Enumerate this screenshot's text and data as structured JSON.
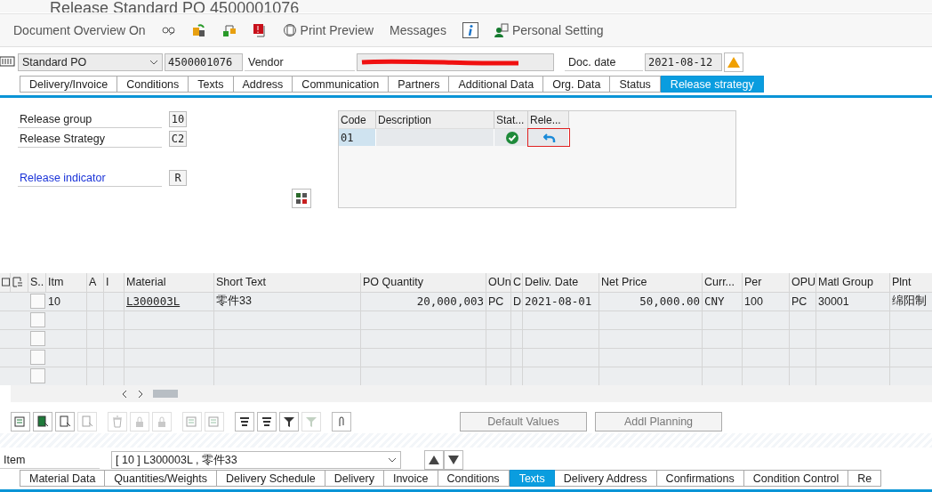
{
  "window": {
    "title": "Release Standard PO 4500001076"
  },
  "toolbar": {
    "items": [
      {
        "kind": "text",
        "label": "Document Overview On"
      },
      {
        "kind": "icon"
      },
      {
        "kind": "icon"
      },
      {
        "kind": "icon"
      },
      {
        "kind": "icon"
      },
      {
        "kind": "icon_text",
        "label": "Print Preview"
      },
      {
        "kind": "text",
        "label": "Messages"
      },
      {
        "kind": "icon"
      },
      {
        "kind": "icon_text",
        "label": "Personal Setting"
      }
    ]
  },
  "header": {
    "doc_type": "Standard PO",
    "po_number": "4500001076",
    "vendor_label": "Vendor",
    "doc_date_label": "Doc. date",
    "doc_date": "2021-08-12"
  },
  "header_tabs": [
    {
      "label": "Delivery/Invoice",
      "selected": false
    },
    {
      "label": "Conditions",
      "selected": false
    },
    {
      "label": "Texts",
      "selected": false
    },
    {
      "label": "Address",
      "selected": false
    },
    {
      "label": "Communication",
      "selected": false
    },
    {
      "label": "Partners",
      "selected": false
    },
    {
      "label": "Additional Data",
      "selected": false
    },
    {
      "label": "Org. Data",
      "selected": false
    },
    {
      "label": "Status",
      "selected": false
    },
    {
      "label": "Release strategy",
      "selected": true
    }
  ],
  "release": {
    "fields": [
      {
        "label": "Release group",
        "value": "10",
        "kind": "plain"
      },
      {
        "label": "Release Strategy",
        "value": "C2",
        "kind": "plain"
      },
      {
        "label": "Release indicator",
        "value": "R",
        "kind": "link"
      }
    ],
    "table": {
      "columns": [
        "Code",
        "Description",
        "Stat...",
        "Rele..."
      ],
      "rows": [
        {
          "code": "01",
          "released": true
        }
      ]
    }
  },
  "items_table": {
    "columns": [
      "S..",
      "Itm",
      "A",
      "I",
      "Material",
      "Short Text",
      "PO Quantity",
      "OUn",
      "C",
      "Deliv. Date",
      "Net Price",
      "Curr...",
      "Per",
      "OPU",
      "Matl Group",
      "Plnt"
    ],
    "rows": [
      {
        "cells": [
          "",
          "10",
          "",
          "",
          "L300003L",
          "零件33",
          "20,000,003",
          "PC",
          "D",
          "2021-08-01",
          "50,000.00",
          "CNY",
          "100",
          "PC",
          "30001",
          "绵阳制"
        ]
      }
    ]
  },
  "actions": [
    "Default Values",
    "Addl Planning"
  ],
  "item": {
    "label": "Item",
    "value": "[ 10 ] L300003L , 零件33"
  },
  "item_tabs": [
    {
      "label": "Material Data",
      "selected": false
    },
    {
      "label": "Quantities/Weights",
      "selected": false
    },
    {
      "label": "Delivery Schedule",
      "selected": false
    },
    {
      "label": "Delivery",
      "selected": false
    },
    {
      "label": "Invoice",
      "selected": false
    },
    {
      "label": "Conditions",
      "selected": false
    },
    {
      "label": "Texts",
      "selected": true
    },
    {
      "label": "Delivery Address",
      "selected": false
    },
    {
      "label": "Confirmations",
      "selected": false
    },
    {
      "label": "Condition Control",
      "selected": false
    },
    {
      "label": "Re",
      "selected": false
    }
  ]
}
